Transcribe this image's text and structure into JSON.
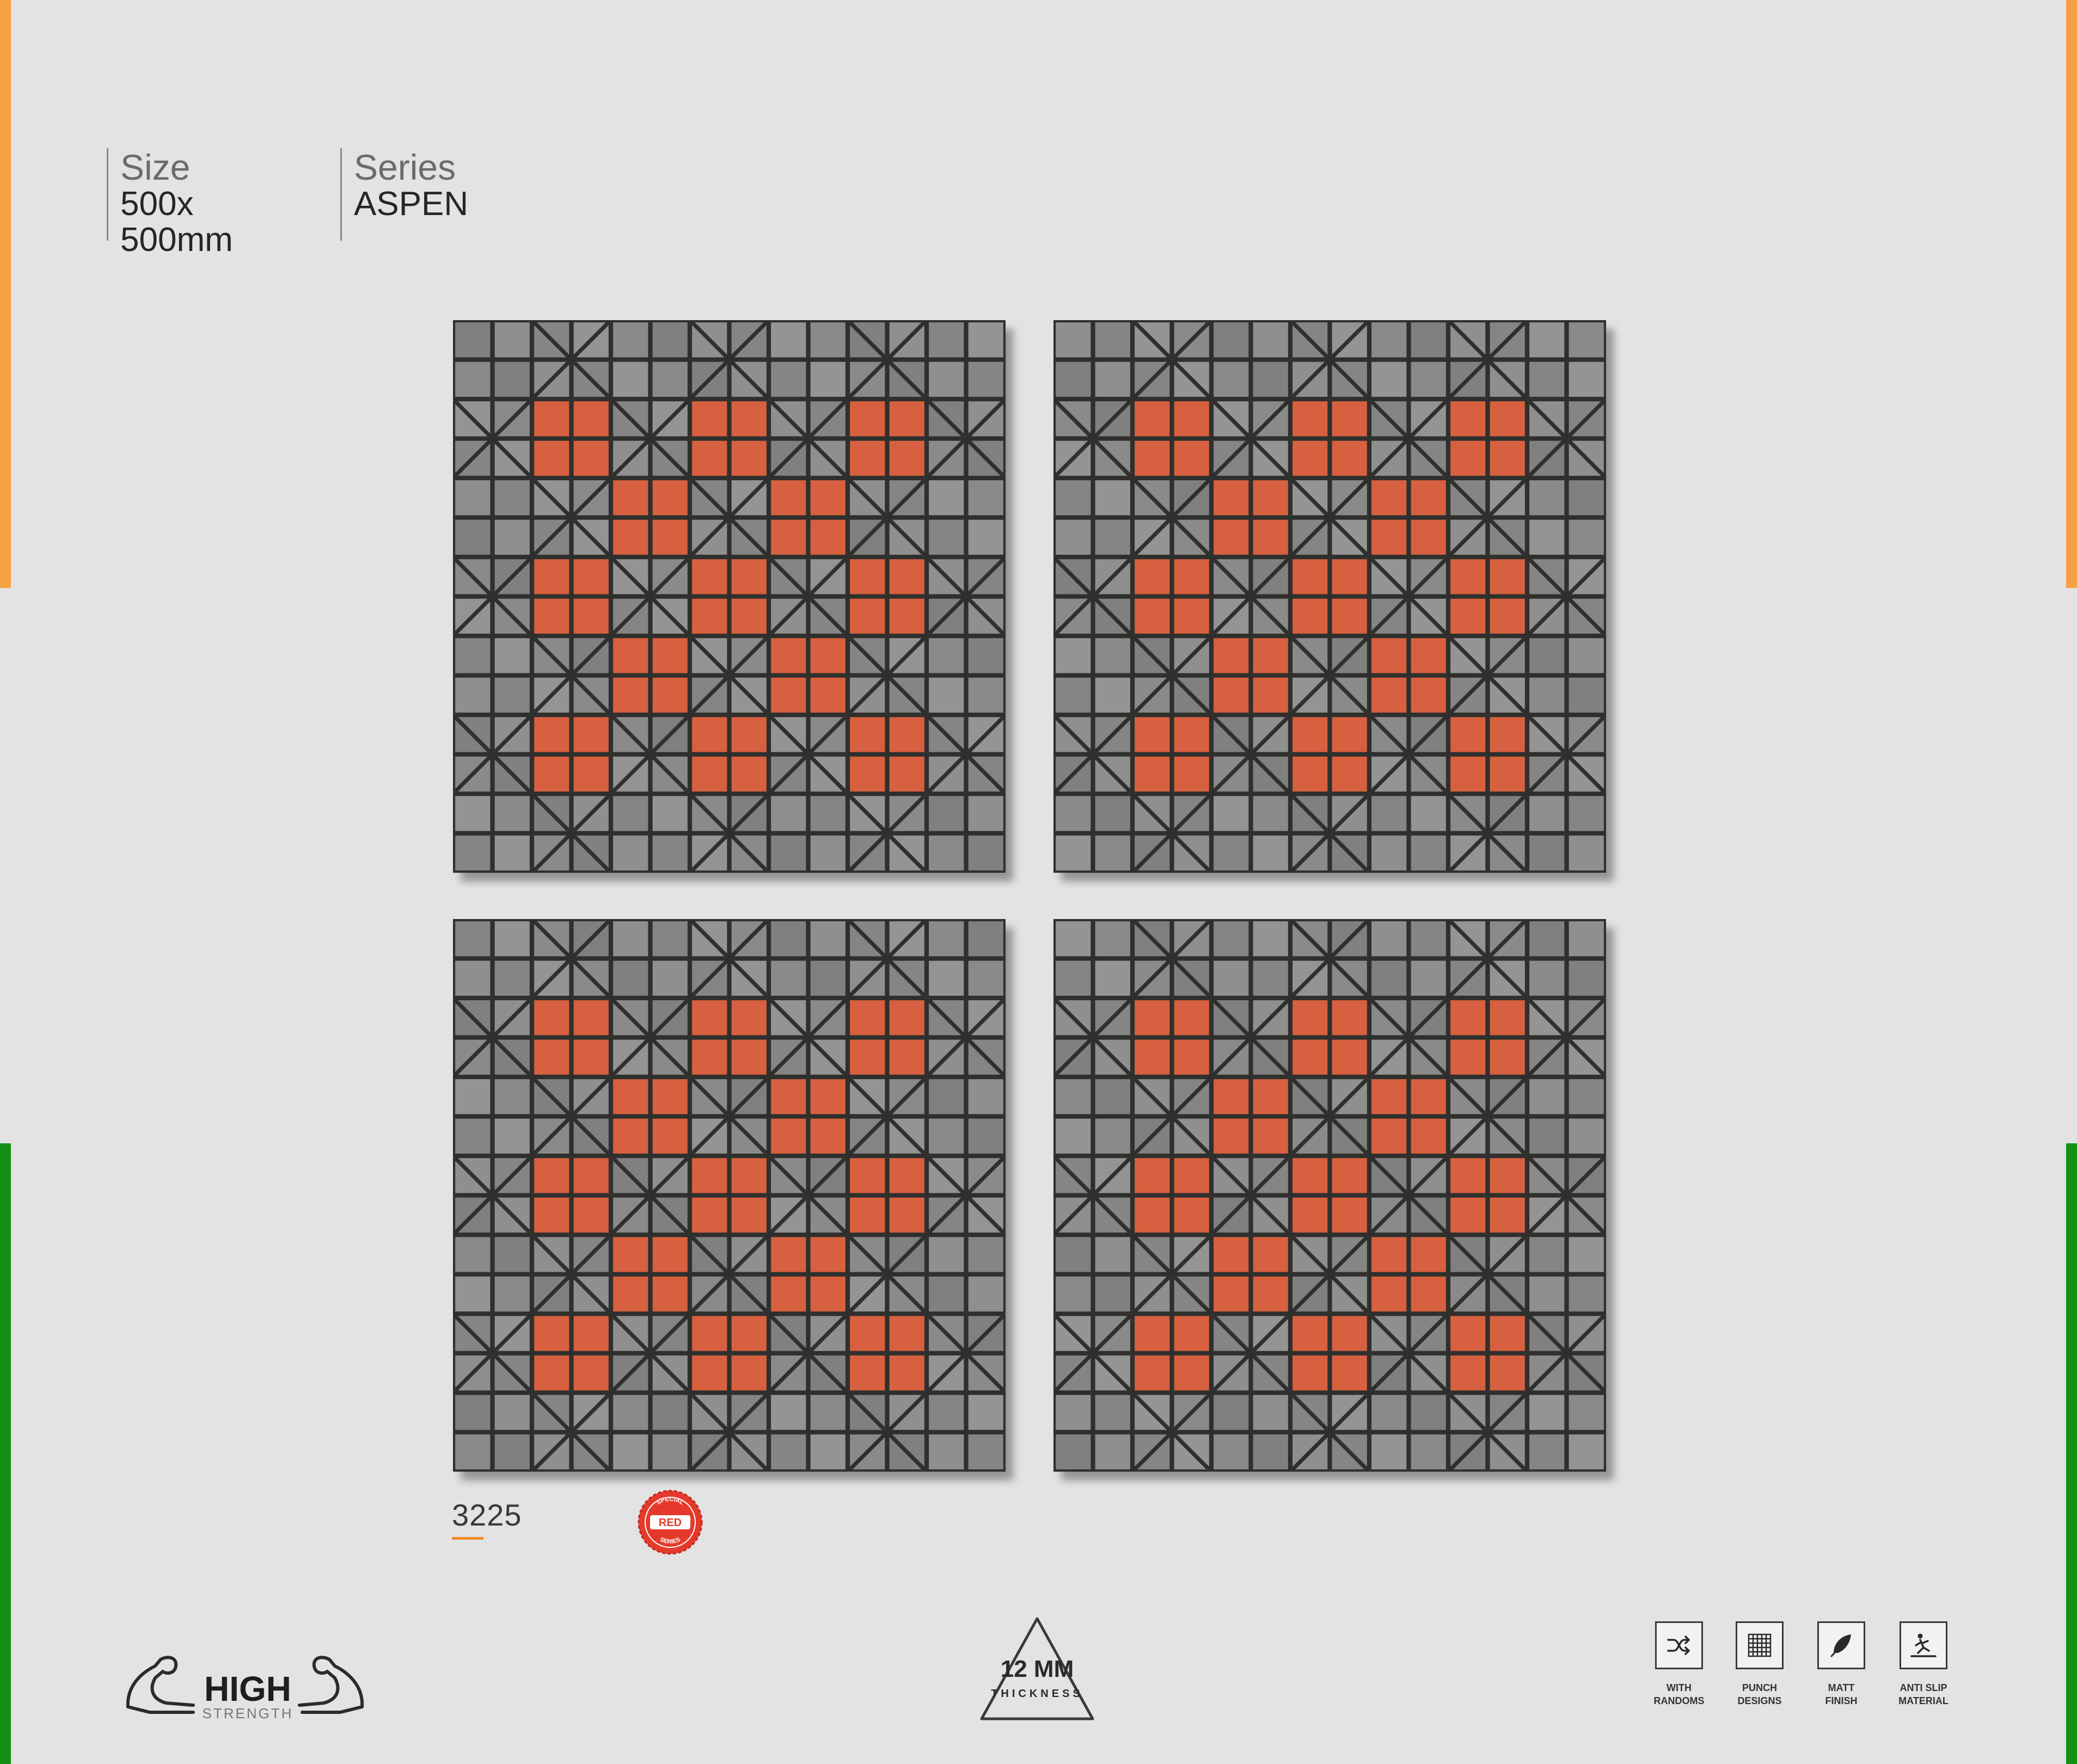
{
  "colors": {
    "flag_saffron": "#f7a043",
    "flag_green": "#149014",
    "background": "#e3e3e3",
    "tile_grey": "#8d8d8b",
    "tile_red": "#d6603f",
    "grout": "#2f302e",
    "badge_red": "#e53a2b"
  },
  "specs": {
    "size_label": "Size",
    "size_value": "500x\n500mm",
    "series_label": "Series",
    "series_value": "ASPEN"
  },
  "product": {
    "code": "3225",
    "badge": {
      "top_text": "SPECIAL",
      "center_text": "RED",
      "bottom_text": "SERIES"
    }
  },
  "footer": {
    "strength": {
      "line1": "HIGH",
      "line2": "STRENGTH",
      "icon": "flexed-arms-icon"
    },
    "thickness": {
      "value": "12 MM",
      "label": "THICKNESS",
      "icon": "triangle-icon"
    },
    "features": [
      {
        "label": "WITH\nRANDOMS",
        "icon": "shuffle-icon"
      },
      {
        "label": "PUNCH\nDESIGNS",
        "icon": "grid-icon"
      },
      {
        "label": "MATT\nFINISH",
        "icon": "feather-icon"
      },
      {
        "label": "ANTI SLIP\nMATERIAL",
        "icon": "slip-figure-icon"
      }
    ]
  }
}
